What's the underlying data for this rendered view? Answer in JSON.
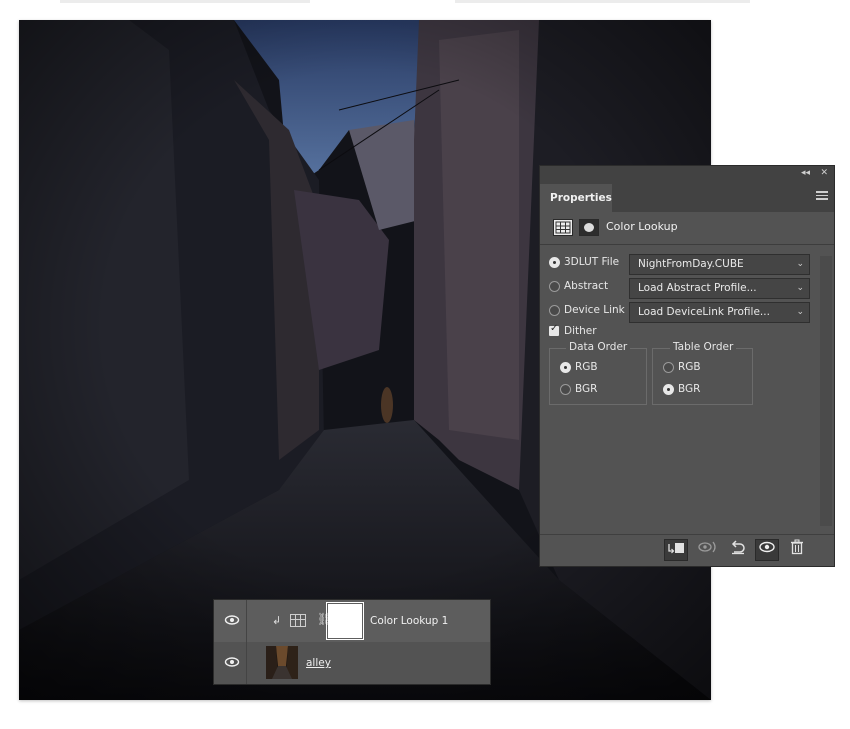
{
  "properties_panel": {
    "tab": "Properties",
    "adjustment_title": "Color Lookup",
    "options": [
      {
        "label": "3DLUT File",
        "selected": true,
        "dropdown": "NightFromDay.CUBE"
      },
      {
        "label": "Abstract",
        "selected": false,
        "dropdown": "Load Abstract Profile..."
      },
      {
        "label": "Device Link",
        "selected": false,
        "dropdown": "Load DeviceLink Profile..."
      }
    ],
    "dither_label": "Dither",
    "dither_checked": true,
    "data_order": {
      "title": "Data Order",
      "rgb": "RGB",
      "bgr": "BGR",
      "selected": "RGB"
    },
    "table_order": {
      "title": "Table Order",
      "rgb": "RGB",
      "bgr": "BGR",
      "selected": "BGR"
    }
  },
  "layers_panel": {
    "layers": [
      {
        "name": "Color Lookup 1",
        "visible": true
      },
      {
        "name": "alley",
        "visible": true
      }
    ]
  },
  "icons": {
    "collapse": "collapse-icon",
    "close": "close-icon",
    "panel_menu": "panel-menu-icon",
    "clip": "clip-to-layer-icon",
    "view_previous": "view-previous-state-icon",
    "reset": "reset-icon",
    "visibility": "eye-icon",
    "delete": "trash-icon"
  },
  "colors": {
    "panel_bg": "#535353",
    "panel_header": "#424242",
    "canvas_dark": "#0e0f14"
  }
}
